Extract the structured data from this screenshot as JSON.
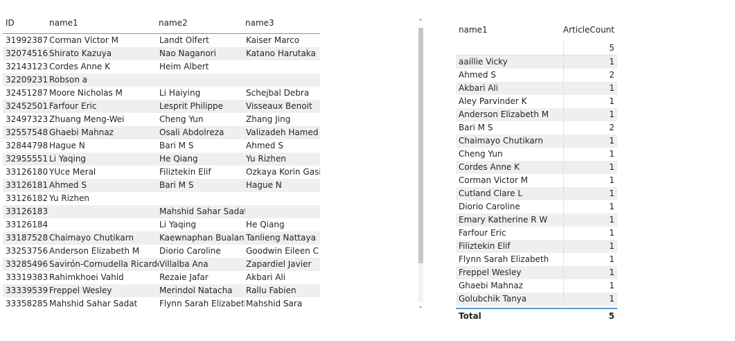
{
  "left_table": {
    "headers": {
      "id": "ID",
      "name1": "name1",
      "name2": "name2",
      "name3": "name3"
    },
    "rows": [
      {
        "id": "31992387",
        "name1": "Corman Victor M",
        "name2": "Landt Olfert",
        "name3": "Kaiser Marco"
      },
      {
        "id": "32074516",
        "name1": "Shirato Kazuya",
        "name2": "Nao Naganori",
        "name3": "Katano Harutaka"
      },
      {
        "id": "32143123",
        "name1": "Cordes Anne K",
        "name2": "Heim Albert",
        "name3": ""
      },
      {
        "id": "32209231",
        "name1": "Robson a",
        "name2": "",
        "name3": ""
      },
      {
        "id": "32451287",
        "name1": "Moore Nicholas M",
        "name2": "Li Haiying",
        "name3": "Schejbal Debra"
      },
      {
        "id": "32452501",
        "name1": "Farfour Eric",
        "name2": "Lesprit Philippe",
        "name3": "Visseaux Benoit"
      },
      {
        "id": "32497323",
        "name1": "Zhuang Meng-Wei",
        "name2": "Cheng Yun",
        "name3": "Zhang Jing"
      },
      {
        "id": "32557548",
        "name1": "Ghaebi Mahnaz",
        "name2": "Osali Abdolreza",
        "name3": "Valizadeh Hamed"
      },
      {
        "id": "32844798",
        "name1": "Hague N",
        "name2": "Bari M S",
        "name3": "Ahmed S"
      },
      {
        "id": "32955551",
        "name1": "Li Yaqing",
        "name2": "He Qiang",
        "name3": "Yu Rizhen"
      },
      {
        "id": "33126180",
        "name1": "YUce Meral",
        "name2": "Filiztekin Elif",
        "name3": "Ozkaya Korin Gasia"
      },
      {
        "id": "33126181",
        "name1": "Ahmed S",
        "name2": "Bari M S",
        "name3": "Hague N"
      },
      {
        "id": "33126182",
        "name1": "Yu Rizhen",
        "name2": "",
        "name3": ""
      },
      {
        "id": "33126183",
        "name1": "",
        "name2": "Mahshid Sahar Sadat",
        "name3": ""
      },
      {
        "id": "33126184",
        "name1": "",
        "name2": "Li Yaqing",
        "name3": "He Qiang"
      },
      {
        "id": "33187528",
        "name1": "Chaimayo Chutikarn",
        "name2": "Kaewnaphan Bualan",
        "name3": "Tanlieng Nattaya"
      },
      {
        "id": "33253756",
        "name1": "Anderson Elizabeth M",
        "name2": "Diorio Caroline",
        "name3": "Goodwin Eileen C"
      },
      {
        "id": "33285496",
        "name1": "Savirón-Cornudella Ricardo",
        "name2": "Villalba Ana",
        "name3": "Zapardiel Javier"
      },
      {
        "id": "33319383",
        "name1": "Rahimkhoei Vahid",
        "name2": "Rezaie Jafar",
        "name3": "Akbari Ali"
      },
      {
        "id": "33339539",
        "name1": "Freppel Wesley",
        "name2": "Merindol Natacha",
        "name3": "Rallu Fabien"
      },
      {
        "id": "33358285",
        "name1": "Mahshid Sahar Sadat",
        "name2": "Flynn Sarah Elizabeth",
        "name3": "Mahshid Sara"
      }
    ]
  },
  "right_table": {
    "headers": {
      "name": "name1",
      "count": "ArticleCount"
    },
    "blank_row": {
      "name": "",
      "count": "5"
    },
    "rows": [
      {
        "name": "aaillie Vicky",
        "count": "1"
      },
      {
        "name": "Ahmed S",
        "count": "2"
      },
      {
        "name": "Akbari Ali",
        "count": "1"
      },
      {
        "name": "Aley Parvinder K",
        "count": "1"
      },
      {
        "name": "Anderson Elizabeth M",
        "count": "1"
      },
      {
        "name": "Bari M S",
        "count": "2"
      },
      {
        "name": "Chaimayo Chutikarn",
        "count": "1"
      },
      {
        "name": "Cheng Yun",
        "count": "1"
      },
      {
        "name": "Cordes Anne K",
        "count": "1"
      },
      {
        "name": "Corman Victor M",
        "count": "1"
      },
      {
        "name": "Cutland Clare L",
        "count": "1"
      },
      {
        "name": "Diorio Caroline",
        "count": "1"
      },
      {
        "name": "Emary Katherine R W",
        "count": "1"
      },
      {
        "name": "Farfour Eric",
        "count": "1"
      },
      {
        "name": "Filiztekin Elif",
        "count": "1"
      },
      {
        "name": "Flynn Sarah Elizabeth",
        "count": "1"
      },
      {
        "name": "Freppel Wesley",
        "count": "1"
      },
      {
        "name": "Ghaebi Mahnaz",
        "count": "1"
      },
      {
        "name": "Golubchik Tanya",
        "count": "1"
      }
    ],
    "total": {
      "label": "Total",
      "count": "5"
    }
  },
  "scrollbar": {
    "up_icon": "chevron-up-icon",
    "down_icon": "chevron-down-icon"
  },
  "colors": {
    "header_rule": "#5b9bd5",
    "alt_row": "#efefef",
    "text": "#252423"
  }
}
